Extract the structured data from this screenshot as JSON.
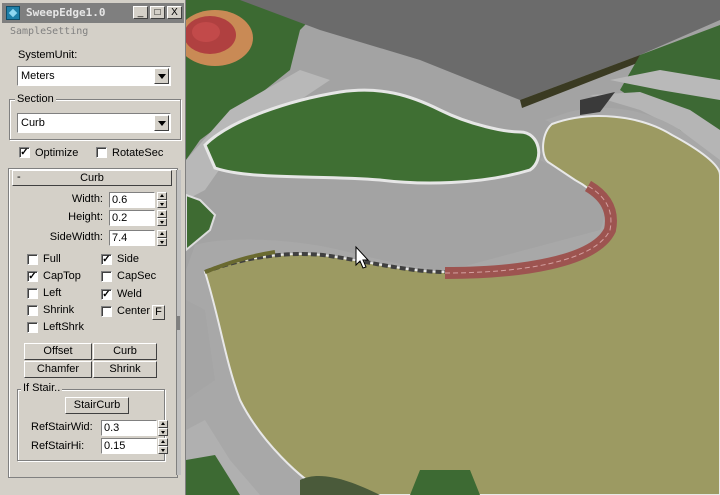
{
  "window": {
    "title": "SweepEdge1.0",
    "subtitle": "SampleSetting",
    "minimize": "_",
    "restore": "□",
    "close": "X"
  },
  "system_unit": {
    "label": "SystemUnit:",
    "value": "Meters"
  },
  "section": {
    "label": "Section",
    "value": "Curb"
  },
  "options": {
    "optimize_label": "Optimize",
    "optimize_checked": true,
    "rotatesec_label": "RotateSec",
    "rotatesec_checked": false
  },
  "rollout": {
    "collapse": "-",
    "title": "Curb",
    "width": {
      "label": "Width:",
      "value": "0.6"
    },
    "height": {
      "label": "Height:",
      "value": "0.2"
    },
    "sidewidth": {
      "label": "SideWidth:",
      "value": "7.4"
    },
    "checks": {
      "full": {
        "label": "Full",
        "checked": false
      },
      "side": {
        "label": "Side",
        "checked": true
      },
      "captop": {
        "label": "CapTop",
        "checked": true
      },
      "capsec": {
        "label": "CapSec",
        "checked": false
      },
      "left": {
        "label": "Left",
        "checked": false
      },
      "weld": {
        "label": "Weld",
        "checked": true
      },
      "shrink": {
        "label": "Shrink",
        "checked": false
      },
      "center": {
        "label": "Center",
        "checked": false
      },
      "leftshrk": {
        "label": "LeftShrk",
        "checked": false
      }
    },
    "center_f_button": "F",
    "buttons": {
      "offset": "Offset",
      "curb": "Curb",
      "chamfer": "Chamfer",
      "shrink": "Shrink"
    },
    "if_stair": {
      "label": "If Stair..",
      "stair_button": "StairCurb",
      "refstairwid": {
        "label": "RefStairWid:",
        "value": "0.3"
      },
      "refstairhi": {
        "label": "RefStairHi:",
        "value": "0.15"
      }
    }
  },
  "check_glyph": "✓",
  "colors": {
    "grass": "#3f6f35",
    "lawn": "#9c9a62",
    "road": "#a6a6a6",
    "roof": "#6e6e6e",
    "brick": "#9d5450",
    "panel": "#d4d0c8"
  }
}
